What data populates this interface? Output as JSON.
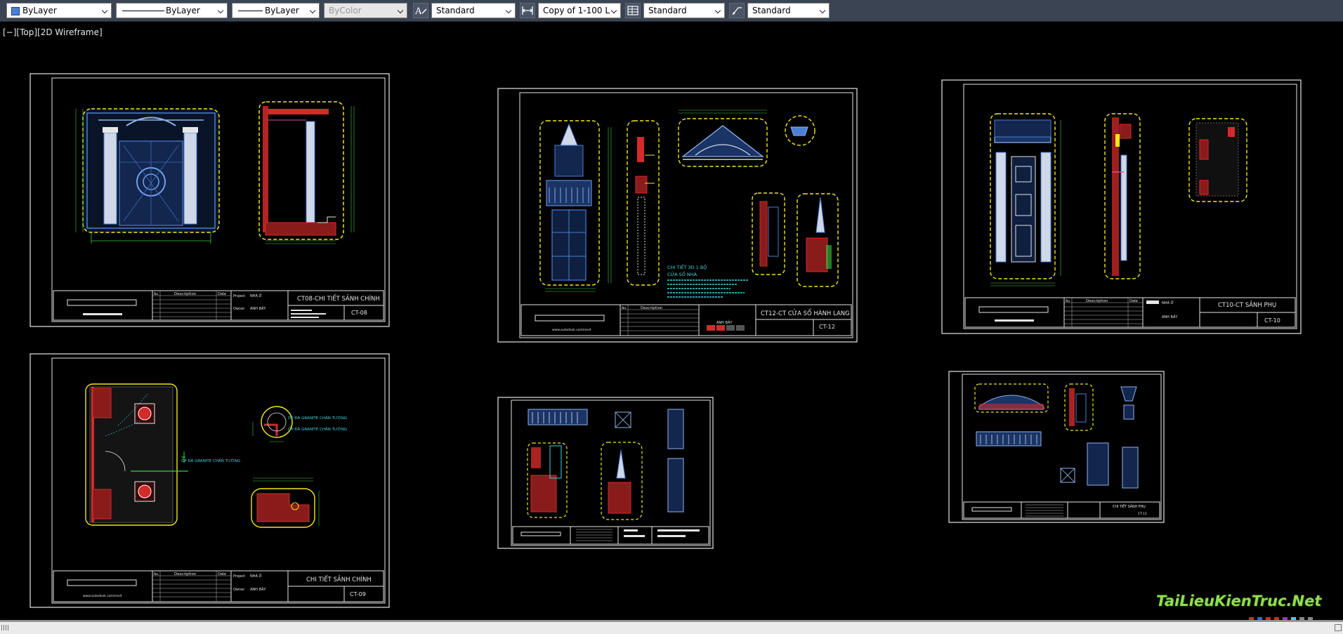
{
  "toolbar": {
    "layer_combo": "ByLayer",
    "linetype_combo": "ByLayer",
    "lineweight_combo": "ByLayer",
    "plotstyle_combo": "ByColor",
    "text_style_combo": "Standard",
    "dim_style_combo": "Copy of 1-100 L",
    "table_style_combo": "Standard",
    "multileader_style_combo": "Standard"
  },
  "viewport": {
    "label": "[−][Top][2D Wireframe]"
  },
  "sheets": [
    {
      "name": "CT08-CHI TIẾT SẢNH CHÍNH",
      "code": "CT-08",
      "project": "NHÀ Ở",
      "owner": "ANH BẢY",
      "desc_header": "Description",
      "no_header": "No.",
      "date_header": "Date",
      "project_label": "Project",
      "owner_label": "Owner"
    },
    {
      "name": "CT12-CT CỬA SỔ HÀNH LANG",
      "code": "CT-12",
      "owner": "ANH BẢY",
      "desc_header": "Description",
      "no_header": "No.",
      "website": "www.autodesk.com/revit"
    },
    {
      "name": "CT10-CT SẢNH PHỤ",
      "code": "CT-10",
      "project": "NHÀ Ở",
      "owner": "ANH BẢY",
      "desc_header": "Description",
      "no_header": "No.",
      "date_header": "Date"
    },
    {
      "name": "CHI TIẾT SẢNH CHÍNH",
      "code": "CT-09",
      "project": "NHÀ Ở",
      "owner": "ANH BẢY",
      "desc_header": "Description",
      "no_header": "No.",
      "date_header": "Date",
      "project_label": "Project",
      "owner_label": "Owner",
      "website": "www.autodesk.com/revit"
    },
    {
      "name": "CHI TIẾT SẢNH PHỤ",
      "code": "CT-11"
    }
  ],
  "annotations": {
    "window_note_1": "CHI TIẾT 3D 1 BỘ",
    "window_note_2": "CỬA SỔ NHÀ",
    "granite_1": "ỐP ĐÁ GRANITE CHÂN TƯỜNG",
    "granite_2": "ỐP ĐÁ GRANITE CHÂN TƯỜNG",
    "granite_3": "ỐP ĐÁ GRANITE CHÂN TƯỜNG"
  },
  "watermark": "TaiLieuKienTruc.Net",
  "colors": {
    "toolbar_bg": "#3b4453",
    "model_space": "#000000",
    "drawing_blue": "#4a7fd4",
    "highlight_yellow": "#f2e81a",
    "dim_green": "#3fcf3f",
    "section_red": "#d42a2a",
    "annotation_cyan": "#3fd6e0",
    "watermark_green": "#8fe04a"
  }
}
